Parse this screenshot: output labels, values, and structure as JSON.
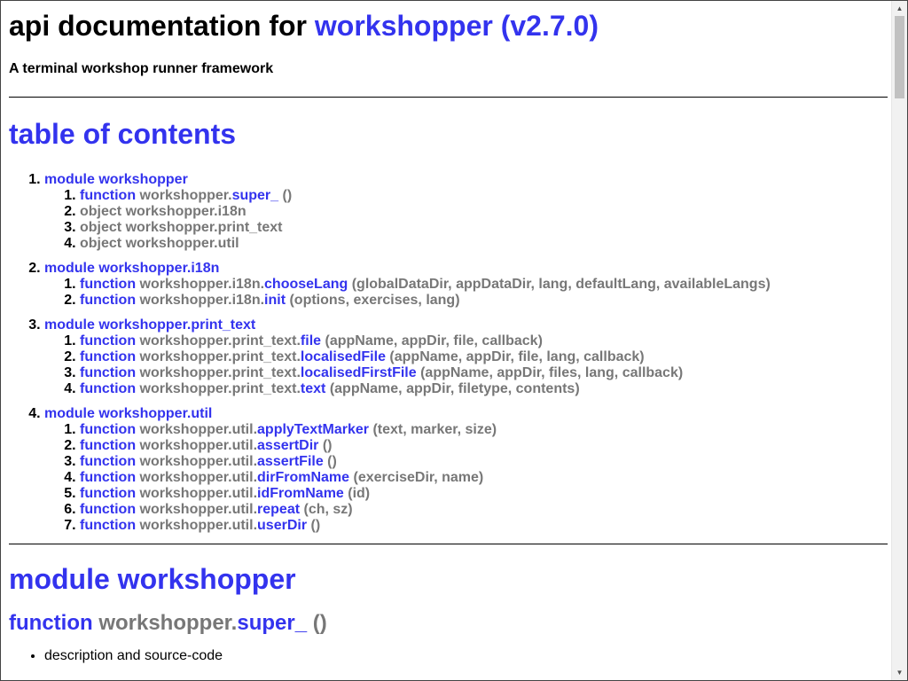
{
  "header": {
    "title_prefix": "api documentation for ",
    "title_link": "workshopper (v2.7.0)",
    "subtitle": "A terminal workshop runner framework"
  },
  "toc": {
    "title": "table of contents",
    "modules": [
      {
        "label": "module workshopper",
        "items": [
          {
            "kind": "function",
            "prefix": "workshopper.",
            "name": "super_",
            "args": " ()"
          },
          {
            "kind": "object",
            "prefix": "workshopper.i18n",
            "name": "",
            "args": ""
          },
          {
            "kind": "object",
            "prefix": "workshopper.print_text",
            "name": "",
            "args": ""
          },
          {
            "kind": "object",
            "prefix": "workshopper.util",
            "name": "",
            "args": ""
          }
        ]
      },
      {
        "label": "module workshopper.i18n",
        "items": [
          {
            "kind": "function",
            "prefix": "workshopper.i18n.",
            "name": "chooseLang",
            "args": " (globalDataDir, appDataDir, lang, defaultLang, availableLangs)"
          },
          {
            "kind": "function",
            "prefix": "workshopper.i18n.",
            "name": "init",
            "args": " (options, exercises, lang)"
          }
        ]
      },
      {
        "label": "module workshopper.print_text",
        "items": [
          {
            "kind": "function",
            "prefix": "workshopper.print_text.",
            "name": "file",
            "args": " (appName, appDir, file, callback)"
          },
          {
            "kind": "function",
            "prefix": "workshopper.print_text.",
            "name": "localisedFile",
            "args": " (appName, appDir, file, lang, callback)"
          },
          {
            "kind": "function",
            "prefix": "workshopper.print_text.",
            "name": "localisedFirstFile",
            "args": " (appName, appDir, files, lang, callback)"
          },
          {
            "kind": "function",
            "prefix": "workshopper.print_text.",
            "name": "text",
            "args": " (appName, appDir, filetype, contents)"
          }
        ]
      },
      {
        "label": "module workshopper.util",
        "items": [
          {
            "kind": "function",
            "prefix": "workshopper.util.",
            "name": "applyTextMarker",
            "args": " (text, marker, size)"
          },
          {
            "kind": "function",
            "prefix": "workshopper.util.",
            "name": "assertDir",
            "args": " ()"
          },
          {
            "kind": "function",
            "prefix": "workshopper.util.",
            "name": "assertFile",
            "args": " ()"
          },
          {
            "kind": "function",
            "prefix": "workshopper.util.",
            "name": "dirFromName",
            "args": " (exerciseDir, name)"
          },
          {
            "kind": "function",
            "prefix": "workshopper.util.",
            "name": "idFromName",
            "args": " (id)"
          },
          {
            "kind": "function",
            "prefix": "workshopper.util.",
            "name": "repeat",
            "args": " (ch, sz)"
          },
          {
            "kind": "function",
            "prefix": "workshopper.util.",
            "name": "userDir",
            "args": " ()"
          }
        ]
      }
    ]
  },
  "section": {
    "module_title": "module workshopper",
    "function_kind": "function",
    "function_prefix": "workshopper.",
    "function_name": "super_",
    "function_args": " ()",
    "bullets": [
      "description and source-code"
    ]
  },
  "colors": {
    "link": "#3333ee",
    "muted": "#777777"
  }
}
